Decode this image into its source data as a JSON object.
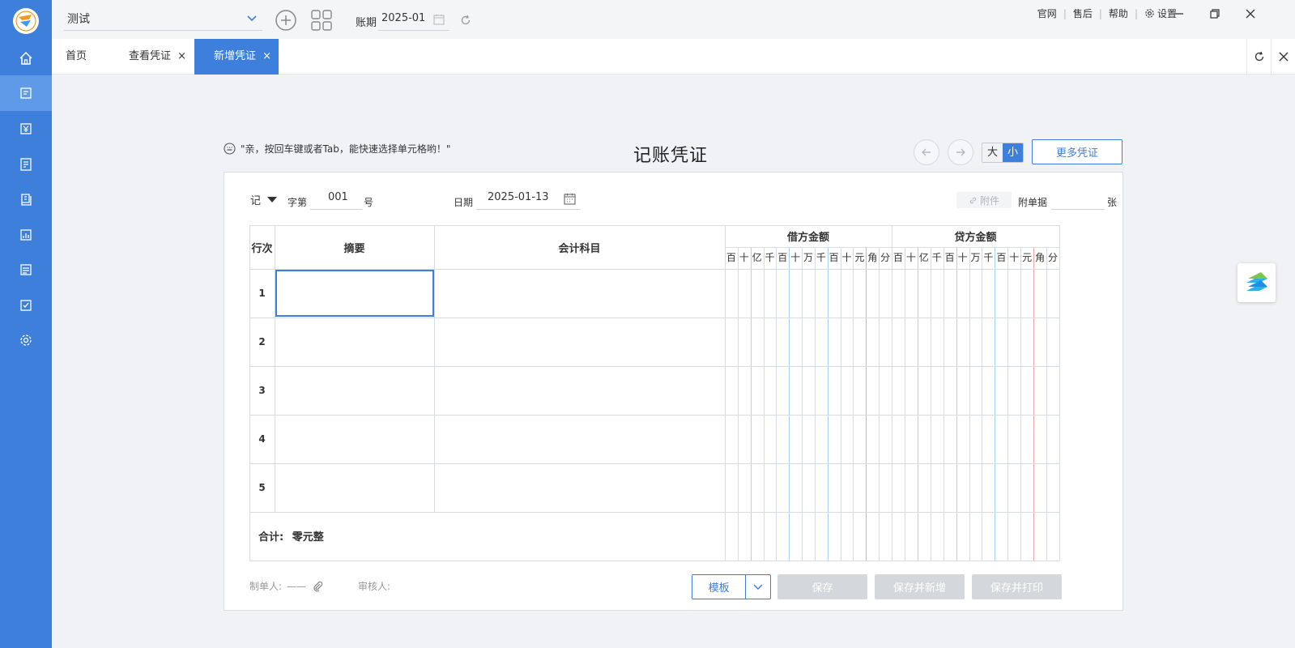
{
  "topbar": {
    "account_name": "测试",
    "period_label": "账期",
    "period_value": "2025-01",
    "links": [
      "官网",
      "售后",
      "帮助",
      "设置"
    ]
  },
  "tabs": [
    {
      "label": "首页",
      "closable": false,
      "active": false
    },
    {
      "label": "查看凭证",
      "closable": true,
      "active": false
    },
    {
      "label": "新增凭证",
      "closable": true,
      "active": true
    }
  ],
  "tab_close_glyph": "×",
  "sidebar": {
    "items": [
      "home-icon",
      "voucher-icon",
      "yuan-icon",
      "ledger-icon",
      "book-icon",
      "report-icon",
      "document-icon",
      "check-icon",
      "gear-icon"
    ],
    "active_index": 1
  },
  "voucher": {
    "hint": "\"亲，按回车键或者Tab，能快速选择单元格哟！\"",
    "title": "记账凭证",
    "size_large": "大",
    "size_small": "小",
    "more_button": "更多凭证",
    "word": "记",
    "word_label": "字第",
    "number": "001",
    "number_suffix": "号",
    "date_label": "日期",
    "date_value": "2025-01-13",
    "attach_button": "附件",
    "attach_doc_label": "附单据",
    "attach_doc_unit": "张"
  },
  "table": {
    "headers": {
      "row_no": "行次",
      "summary": "摘要",
      "account": "会计科目",
      "debit": "借方金额",
      "credit": "贷方金额"
    },
    "digit_units": [
      "百",
      "十",
      "亿",
      "千",
      "百",
      "十",
      "万",
      "千",
      "百",
      "十",
      "元",
      "角",
      "分"
    ],
    "rows": [
      "1",
      "2",
      "3",
      "4",
      "5"
    ],
    "total_label": "合计:",
    "total_value": "零元整"
  },
  "footer": {
    "maker_label": "制单人:",
    "maker_value": "——",
    "reviewer_label": "审核人:",
    "template_button": "模板",
    "save_button": "保存",
    "save_new_button": "保存并新增",
    "save_print_button": "保存并打印"
  },
  "colors": {
    "primary": "#3d7fdb",
    "sidebar": "#3d7fdb",
    "disabled_button": "#d4d7db",
    "yuan_line": "#f0a9a9",
    "thousand_line": "#a8d4f2"
  }
}
